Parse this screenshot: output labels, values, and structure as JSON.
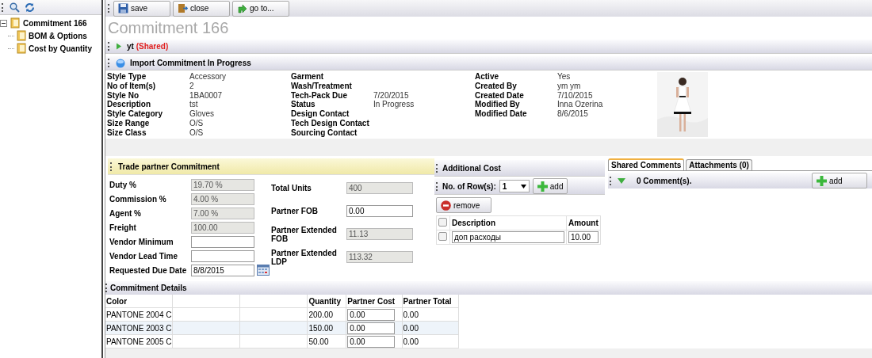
{
  "tree": [
    {
      "label": "Commitment 166",
      "expanded": true,
      "children": [
        {
          "label": "BOM & Options"
        },
        {
          "label": "Cost by Quantity"
        }
      ]
    }
  ],
  "toolbar": {
    "buttons": [
      {
        "label": "save",
        "kind": "save"
      },
      {
        "label": "close",
        "kind": "close"
      },
      {
        "label": "go to...",
        "kind": "goto"
      }
    ]
  },
  "title": "Commitment 166",
  "shared_bar": {
    "name": "yt",
    "tag": "(Shared)"
  },
  "status_bar": {
    "label": "Import Commitment In Progress"
  },
  "info_columns": [
    [
      {
        "label": "Style Type",
        "value": "Accessory"
      },
      {
        "label": "No of Item(s)",
        "value": "2"
      },
      {
        "label": "Style No",
        "value": "1BA0007"
      },
      {
        "label": "Description",
        "value": "tst"
      },
      {
        "label": "Style Category",
        "value": "Gloves"
      },
      {
        "label": "Size Range",
        "value": "O/S"
      },
      {
        "label": "Size Class",
        "value": "O/S"
      }
    ],
    [
      {
        "label": "Garment"
      },
      {
        "label": "Wash/Treatment"
      },
      {
        "label": "Tech-Pack Due",
        "value": "7/20/2015"
      },
      {
        "label": "Status",
        "value": "In Progress"
      },
      {
        "label": "Design Contact"
      },
      {
        "label": "Tech Design Contact"
      },
      {
        "label": "Sourcing Contact"
      }
    ],
    [
      {
        "label": "Active",
        "value": "Yes"
      },
      {
        "label": "Created By",
        "value": "ym ym"
      },
      {
        "label": "Created Date",
        "value": "7/10/2015"
      },
      {
        "label": "Modified By",
        "value": "Inna Ozerina"
      },
      {
        "label": "Modified Date",
        "value": "8/6/2015"
      }
    ]
  ],
  "trade_partner": {
    "title": "Trade partner Commitment",
    "left": [
      {
        "label": "Duty %",
        "value": "19.70 %",
        "disabled": true
      },
      {
        "label": "Commission %",
        "value": "4.00 %",
        "disabled": true
      },
      {
        "label": "Agent %",
        "value": "7.00 %",
        "disabled": true
      },
      {
        "label": "Freight",
        "value": "100.00",
        "disabled": true
      },
      {
        "label": "Vendor Minimum",
        "disabled": false
      },
      {
        "label": "Vendor Lead Time",
        "disabled": false
      },
      {
        "label": "Requested Due Date",
        "value": "8/8/2015",
        "disabled": false,
        "kind": "date"
      }
    ],
    "right": [
      {
        "label": "Total Units",
        "value": "400",
        "disabled": true
      },
      {
        "label": "Partner FOB",
        "value": "0.00",
        "disabled": false
      },
      {
        "label": "Partner Extended FOB",
        "value": "11.13",
        "disabled": true
      },
      {
        "label": "Partner Extended LDP",
        "value": "113.32",
        "disabled": true
      }
    ]
  },
  "additional_cost": {
    "title": "Additional Cost",
    "rows_label": "No. of Row(s):",
    "rows_value": "1",
    "add": "add",
    "remove": "remove",
    "columns": [
      "Description",
      "Amount"
    ],
    "header_checked": false,
    "rows": [
      {
        "checked": false,
        "description": "доп расходы",
        "amount": "10.00"
      }
    ]
  },
  "comments": {
    "tabs": [
      {
        "label": "Shared Comments",
        "selected": true
      },
      {
        "label": "Attachments (0)",
        "selected": false
      }
    ],
    "count": "0 Comment(s).",
    "add": "add"
  },
  "details": {
    "title": "Commitment Details",
    "columns": [
      "Color",
      "Quantity",
      "Partner Cost",
      "Partner Total"
    ],
    "rows": [
      {
        "color_name": "PANTONE 2004 C",
        "quantity": "200.00",
        "partner_cost": "0.00",
        "partner_total": "0.00"
      },
      {
        "color_name": "PANTONE 2003 C",
        "quantity": "150.00",
        "partner_cost": "0.00",
        "partner_total": "0.00"
      },
      {
        "color_name": "PANTONE 2005 C",
        "quantity": "50.00",
        "partner_cost": "0.00",
        "partner_total": "0.00"
      }
    ]
  }
}
